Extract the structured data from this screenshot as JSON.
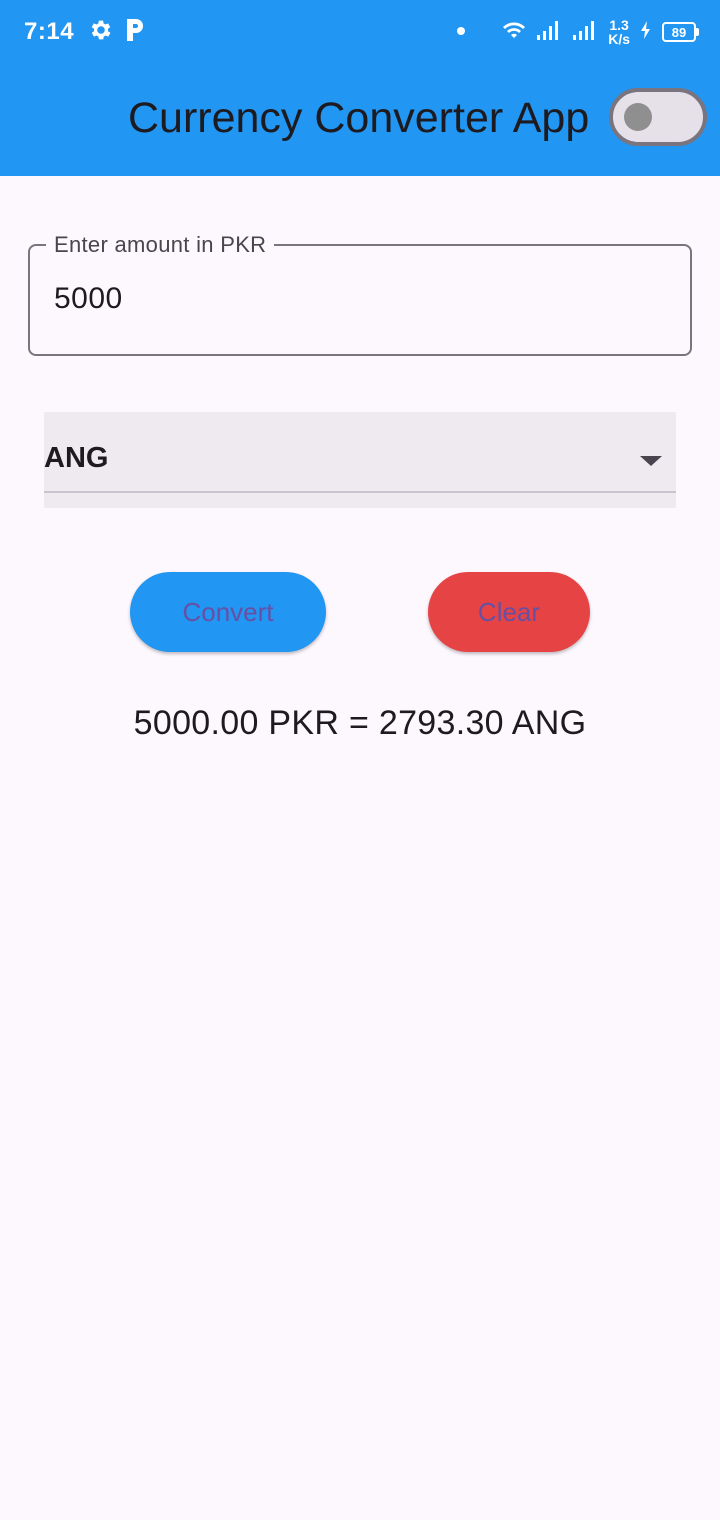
{
  "status_bar": {
    "time": "7:14",
    "net_speed_value": "1.3",
    "net_speed_unit": "K/s",
    "battery": "89",
    "icons": [
      "gear-icon",
      "p-app-icon",
      "notification-dot-icon",
      "wifi-icon",
      "signal-icon",
      "signal-icon",
      "charging-icon"
    ]
  },
  "app_bar": {
    "title": "Currency Converter App",
    "theme_switch_on": false,
    "color": "#2196f3"
  },
  "form": {
    "amount_label": "Enter amount in PKR",
    "amount_value": "5000",
    "currency_selected": "ANG"
  },
  "buttons": {
    "convert_label": "Convert",
    "clear_label": "Clear",
    "convert_color": "#2196f3",
    "clear_color": "#e64444"
  },
  "result": {
    "text": "5000.00 PKR = 2793.30 ANG"
  }
}
